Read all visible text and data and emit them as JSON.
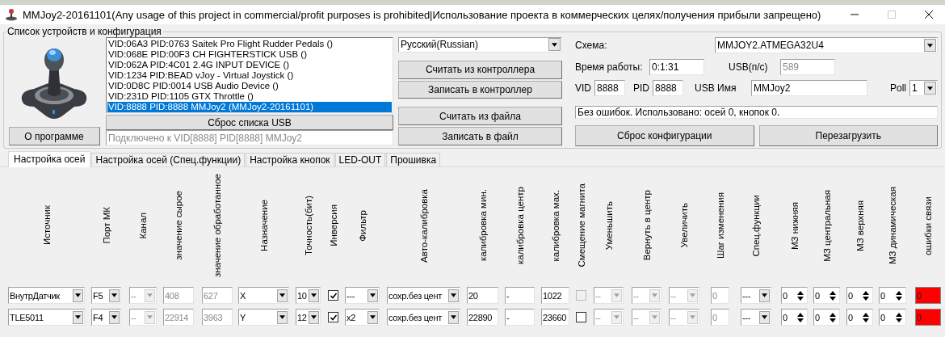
{
  "window": {
    "title": "MMJoy2-20161101(Any usage of this project in commercial/profit purposes is prohibited|Использование проекта в коммерческих целях/получения прибыли запрещено)"
  },
  "devices_group": {
    "title": "Список устройств и конфигурация",
    "about_button": "О программе",
    "device_list": [
      {
        "label": "VID:06A3 PID:0763 Saitek Pro Flight Rudder Pedals ()",
        "selected": false
      },
      {
        "label": "VID:068E PID:00F3 CH FIGHTERSTICK USB  ()",
        "selected": false
      },
      {
        "label": "VID:062A PID:4C01 2.4G INPUT DEVICE ()",
        "selected": false
      },
      {
        "label": "VID:1234 PID:BEAD vJoy - Virtual Joystick ()",
        "selected": false
      },
      {
        "label": "VID:0D8C PID:0014 USB Audio Device ()",
        "selected": false
      },
      {
        "label": "VID:231D PID:1105 GTX Throttle  ()",
        "selected": false
      },
      {
        "label": "VID:8888 PID:8888 MMJoy2 (MMJoy2-20161101)",
        "selected": true
      }
    ],
    "reset_usb_button": "Сброс списка USB",
    "connection_field": "Подключено к VID[8888] PID[8888] MMJoy2",
    "language": "Русский(Russian)",
    "action_buttons": [
      "Считать из контроллера",
      "Записать в контроллер",
      "Считать из файла",
      "Записать в файл"
    ],
    "scheme_label": "Схема:",
    "scheme": "MMJOY2.ATMEGA32U4",
    "uptime_label": "Время работы:",
    "uptime": "0:1:31",
    "usb_rate_label": "USB(п/с)",
    "usb_rate": "589",
    "vid_label": "VID",
    "vid": "8888",
    "pid_label": "PID",
    "pid": "8888",
    "usb_name_label": "USB Имя",
    "usb_name": "MMJoy2",
    "poll_label": "Poll",
    "poll": "1",
    "status": "Без ошибок. Использовано: осей  0, кнопок  0.",
    "config_buttons": [
      "Сброс конфигурации",
      "Перезагрузить"
    ]
  },
  "tabs": [
    {
      "label": "Настройка осей",
      "selected": true
    },
    {
      "label": "Настройка осей (Спец.функции)",
      "selected": false
    },
    {
      "label": "Настройка кнопок",
      "selected": false
    },
    {
      "label": "LED-OUT",
      "selected": false
    },
    {
      "label": "Прошивка",
      "selected": false
    }
  ],
  "table": {
    "columns": [
      "Источник",
      "Порт МК",
      "Канал",
      "значение сырое",
      "значение обработанное",
      "Назначение",
      "Точность(бит)",
      "Инверсия",
      "Фильтр",
      "Авто-калибровка",
      "калибровка мин.",
      "калибровка центр",
      "калибровка мах.",
      "Смещение магнита",
      "Уменьшить",
      "Вернуть в центр",
      "Увеличить",
      "Шаг изменения",
      "Спец.функции",
      "МЗ нижняя",
      "МЗ центральная",
      "МЗ верхняя",
      "МЗ динамическая",
      "ошибки связи"
    ],
    "rows": [
      {
        "cells": [
          {
            "kind": "select",
            "value": "ВнутрДатчик",
            "disabled": false
          },
          {
            "kind": "select",
            "value": "F5",
            "disabled": false
          },
          {
            "kind": "select",
            "value": "--",
            "disabled": true
          },
          {
            "kind": "text",
            "value": "408",
            "disabled": true
          },
          {
            "kind": "text",
            "value": "627",
            "disabled": true
          },
          {
            "kind": "select",
            "value": "X",
            "disabled": false
          },
          {
            "kind": "select",
            "value": "10",
            "disabled": false
          },
          {
            "kind": "checkbox",
            "checked": true,
            "disabled": false
          },
          {
            "kind": "select",
            "value": "---",
            "disabled": false
          },
          {
            "kind": "select",
            "value": "сохр.без цент",
            "disabled": false
          },
          {
            "kind": "text",
            "value": "20",
            "disabled": false
          },
          {
            "kind": "text",
            "value": "-",
            "disabled": false
          },
          {
            "kind": "text",
            "value": "1022",
            "disabled": false
          },
          {
            "kind": "checkbox",
            "checked": false,
            "disabled": true
          },
          {
            "kind": "select",
            "value": "--",
            "disabled": true
          },
          {
            "kind": "select",
            "value": "--",
            "disabled": true
          },
          {
            "kind": "select",
            "value": "--",
            "disabled": true
          },
          {
            "kind": "text",
            "value": "0",
            "disabled": true
          },
          {
            "kind": "select",
            "value": "---",
            "disabled": false
          },
          {
            "kind": "spin",
            "value": "0"
          },
          {
            "kind": "spin",
            "value": "0"
          },
          {
            "kind": "spin",
            "value": "0"
          },
          {
            "kind": "spin",
            "value": "0"
          },
          {
            "kind": "indicator",
            "value": "0",
            "color": "#ff0000"
          }
        ]
      },
      {
        "cells": [
          {
            "kind": "select",
            "value": "TLE5011",
            "disabled": false
          },
          {
            "kind": "select",
            "value": "F4",
            "disabled": false
          },
          {
            "kind": "select",
            "value": "--",
            "disabled": true
          },
          {
            "kind": "text",
            "value": "22914",
            "disabled": true
          },
          {
            "kind": "text",
            "value": "3963",
            "disabled": true
          },
          {
            "kind": "select",
            "value": "Y",
            "disabled": false
          },
          {
            "kind": "select",
            "value": "12",
            "disabled": false
          },
          {
            "kind": "checkbox",
            "checked": true,
            "disabled": false
          },
          {
            "kind": "select",
            "value": "x2",
            "disabled": false
          },
          {
            "kind": "select",
            "value": "сохр.без цент",
            "disabled": false
          },
          {
            "kind": "text",
            "value": "22890",
            "disabled": false
          },
          {
            "kind": "text",
            "value": "-",
            "disabled": false
          },
          {
            "kind": "text",
            "value": "23660",
            "disabled": false
          },
          {
            "kind": "checkbox",
            "checked": false,
            "disabled": false
          },
          {
            "kind": "select",
            "value": "--",
            "disabled": true
          },
          {
            "kind": "select",
            "value": "--",
            "disabled": true
          },
          {
            "kind": "select",
            "value": "--",
            "disabled": true
          },
          {
            "kind": "text",
            "value": "0",
            "disabled": true
          },
          {
            "kind": "select",
            "value": "---",
            "disabled": false
          },
          {
            "kind": "spin",
            "value": "0"
          },
          {
            "kind": "spin",
            "value": "0"
          },
          {
            "kind": "spin",
            "value": "0"
          },
          {
            "kind": "spin",
            "value": "0"
          },
          {
            "kind": "indicator",
            "value": "0",
            "color": "#ff0000"
          }
        ]
      }
    ]
  }
}
